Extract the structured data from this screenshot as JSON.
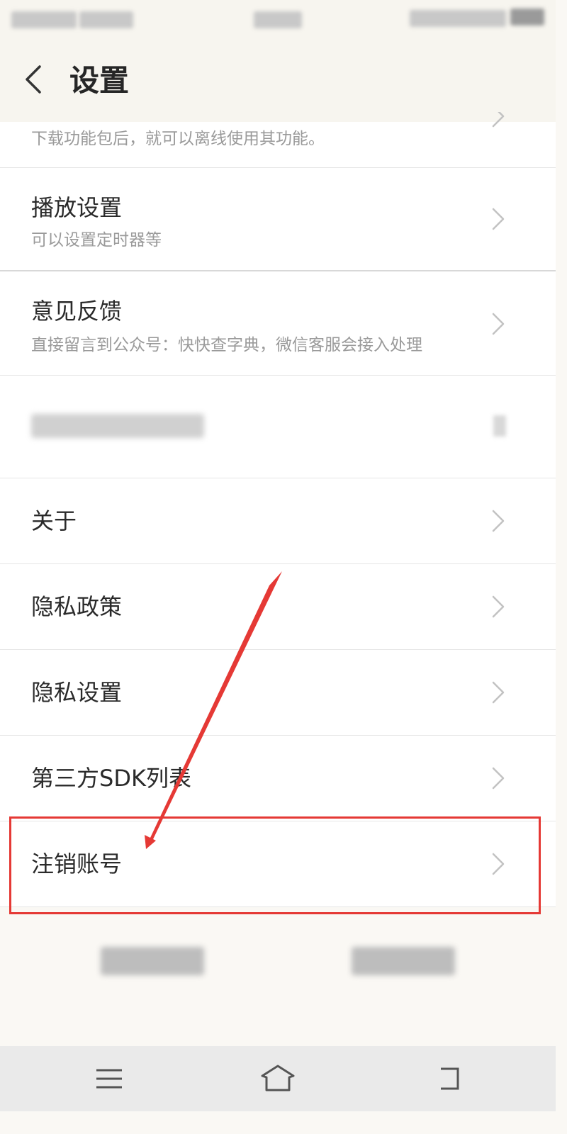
{
  "header": {
    "title": "设置"
  },
  "rows": [
    {
      "desc": "下载功能包后，就可以离线使用其功能。"
    },
    {
      "label": "播放设置",
      "desc": "可以设置定时器等"
    },
    {
      "label": "意见反馈",
      "desc": "直接留言到公众号：快快查字典，微信客服会接入处理"
    },
    {
      "label": ""
    },
    {
      "label": "关于"
    },
    {
      "label": "隐私政策"
    },
    {
      "label": "隐私设置"
    },
    {
      "label": "第三方SDK列表"
    },
    {
      "label": "注销账号"
    }
  ],
  "icons": {
    "back": "chevron-left-icon",
    "row": "chevron-right-icon",
    "menu": "menu-icon",
    "home": "home-icon",
    "backnav": "back-icon"
  },
  "colors": {
    "highlight": "#e53935",
    "arrow": "#e53935"
  }
}
